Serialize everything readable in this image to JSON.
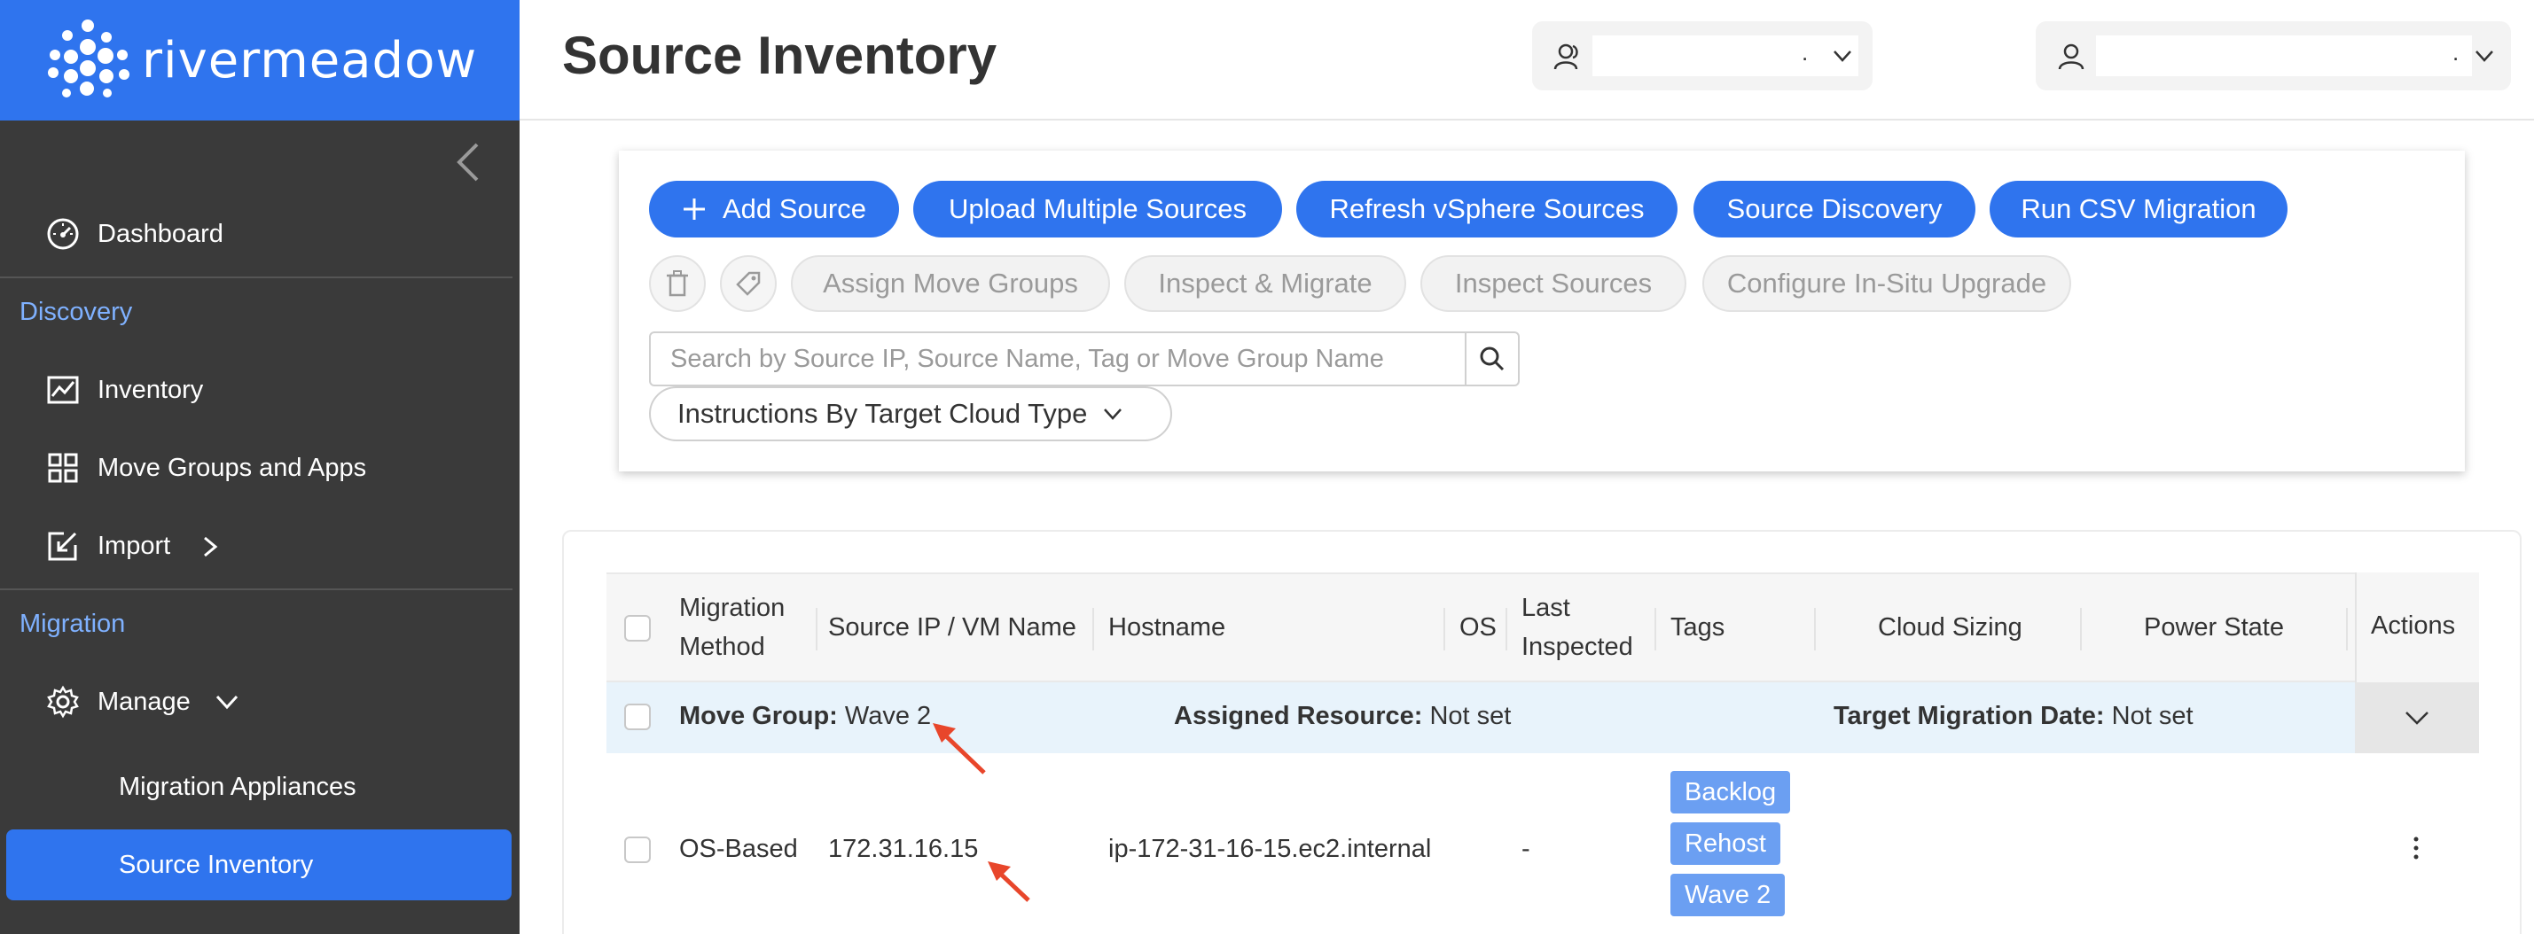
{
  "brand": {
    "name": "rivermeadow"
  },
  "sidebar": {
    "collapse_icon": "chevron-left-icon",
    "items": [
      {
        "label": "Dashboard",
        "icon": "gauge-icon"
      },
      {
        "label": "Inventory",
        "icon": "chart-line-icon"
      },
      {
        "label": "Move Groups and Apps",
        "icon": "grid-icon"
      },
      {
        "label": "Import",
        "icon": "import-icon"
      },
      {
        "label": "Manage",
        "icon": "gear-icon"
      }
    ],
    "sections": {
      "discovery": "Discovery",
      "migration": "Migration"
    },
    "sub_items": [
      {
        "label": "Migration Appliances"
      },
      {
        "label": "Source Inventory",
        "active": true
      }
    ]
  },
  "header": {
    "title": "Source Inventory",
    "selector_1": {
      "icon": "users-icon",
      "trailing": "."
    },
    "selector_2": {
      "icon": "user-icon",
      "trailing": "."
    }
  },
  "toolbar": {
    "primary_buttons": [
      {
        "label": "Add Source",
        "icon": "plus-icon"
      },
      {
        "label": "Upload Multiple Sources"
      },
      {
        "label": "Refresh vSphere Sources"
      },
      {
        "label": "Source Discovery"
      },
      {
        "label": "Run CSV Migration"
      }
    ],
    "disabled_buttons": [
      {
        "label": "Assign Move Groups"
      },
      {
        "label": "Inspect & Migrate"
      },
      {
        "label": "Inspect Sources"
      },
      {
        "label": "Configure In-Situ Upgrade"
      }
    ],
    "icon_buttons": [
      "trash-icon",
      "tag-icon"
    ],
    "search": {
      "placeholder": "Search by Source IP, Source Name, Tag or Move Group Name",
      "value": ""
    },
    "instructions_label": "Instructions By Target Cloud Type"
  },
  "table": {
    "headers": {
      "migration_method_1": "Migration",
      "migration_method_2": "Method",
      "source_ip": "Source IP / VM Name",
      "hostname": "Hostname",
      "os": "OS",
      "last_inspected_1": "Last",
      "last_inspected_2": "Inspected",
      "tags": "Tags",
      "cloud_sizing": "Cloud Sizing",
      "power_state": "Power State",
      "actions": "Actions"
    },
    "group_row": {
      "move_group_label": "Move Group:",
      "move_group_value": "Wave 2",
      "assigned_resource_label": "Assigned Resource:",
      "assigned_resource_value": "Not set",
      "target_date_label": "Target Migration Date:",
      "target_date_value": "Not set"
    },
    "rows": [
      {
        "migration_method": "OS-Based",
        "source_ip": "172.31.16.15",
        "hostname": "ip-172-31-16-15.ec2.internal",
        "os": "-",
        "tags": [
          "Backlog",
          "Rehost",
          "Wave 2"
        ],
        "actions_icon": "kebab-icon"
      }
    ]
  },
  "annotations": {
    "arrow_color": "#e8462b"
  },
  "colors": {
    "brand_blue": "#2f74ee",
    "sidebar_bg": "#3a3a3a",
    "section_text": "#7fb1ff",
    "tag_bg": "#6b9ff2",
    "group_row_bg": "#e8f3fb"
  }
}
